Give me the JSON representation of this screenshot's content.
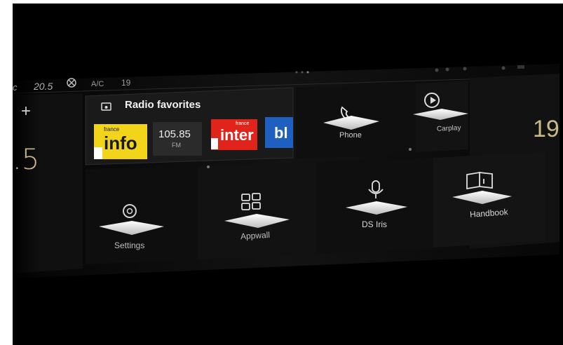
{
  "status_bar": {
    "left_temp_unit": "c",
    "left_temp": "20.5",
    "ac_label": "A/C",
    "fan_level": "19"
  },
  "left_panel": {
    "plus_label": "+",
    "temp_value": ".5"
  },
  "right_panel": {
    "temp_value": "19"
  },
  "radio": {
    "title": "Radio favorites",
    "stations": [
      {
        "name": "france info",
        "logo_top": "france",
        "logo_main": "info"
      },
      {
        "name": "105.85 FM",
        "freq": "105.85",
        "band": "FM"
      },
      {
        "name": "france inter",
        "logo_top": "france",
        "logo_main": "inter"
      },
      {
        "name": "bleu",
        "logo_main": "bl"
      }
    ]
  },
  "tiles": {
    "phone": "Phone",
    "carplay": "Carplay",
    "settings": "Settings",
    "appwall": "Appwall",
    "ds_iris": "DS Iris",
    "handbook": "Handbook"
  },
  "colors": {
    "background": "#000000",
    "tile_dark": "#141414",
    "text_light": "#d8d8d8",
    "france_info_yellow": "#f2d41a",
    "france_inter_red": "#e0241b",
    "bleu_blue": "#1f5fbf"
  }
}
